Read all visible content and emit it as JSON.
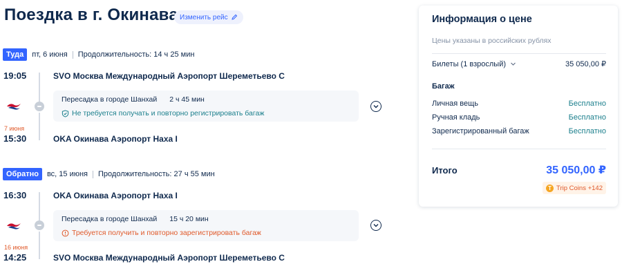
{
  "header": {
    "title": "Поездка в г. Окинава",
    "change_flight_label": "Изменить рейс"
  },
  "outbound": {
    "badge": "Туда",
    "date": "пт, 6 июня",
    "duration": "Продолжительность: 14 ч 25 мин",
    "depart_time": "19:05",
    "depart_airport": "SVO Москва Международный Аэропорт Шереметьево C",
    "transfer_city": "Пересадка в городе Шанхай",
    "transfer_time": "2 ч 45 мин",
    "baggage_note": "Не требуется получать и повторно регистрировать багаж",
    "arrive_date": "7 июня",
    "arrive_time": "15:30",
    "arrive_airport": "OKA Окинава Аэропорт Наха I"
  },
  "inbound": {
    "badge": "Обратно",
    "date": "вс, 15 июня",
    "duration": "Продолжительность: 27 ч 55 мин",
    "depart_time": "16:30",
    "depart_airport": "OKA Окинава Аэропорт Наха I",
    "transfer_city": "Пересадка в городе Шанхай",
    "transfer_time": "15 ч 20 мин",
    "baggage_note": "Требуется получить и повторно зарегистрировать багаж",
    "arrive_date": "16 июня",
    "arrive_time": "14:25",
    "arrive_airport": "SVO Москва Международный Аэропорт Шереметьево C"
  },
  "price": {
    "title": "Информация о цене",
    "currency_note": "Цены указаны в российских рублях",
    "tickets_label": "Билеты (1 взрослый)",
    "tickets_value": "35 050,00 ₽",
    "baggage_heading": "Багаж",
    "baggage": [
      {
        "label": "Личная вещь",
        "value": "Бесплатно"
      },
      {
        "label": "Ручная кладь",
        "value": "Бесплатно"
      },
      {
        "label": "Зарегистрированный багаж",
        "value": "Бесплатно"
      }
    ],
    "total_label": "Итого",
    "total_value": "35 050,00 ₽",
    "coins_label": "Trip Coins +142"
  },
  "colors": {
    "accent": "#3264ff",
    "free": "#1b7f8c",
    "warning": "#e05a2b",
    "text": "#0f294d"
  }
}
